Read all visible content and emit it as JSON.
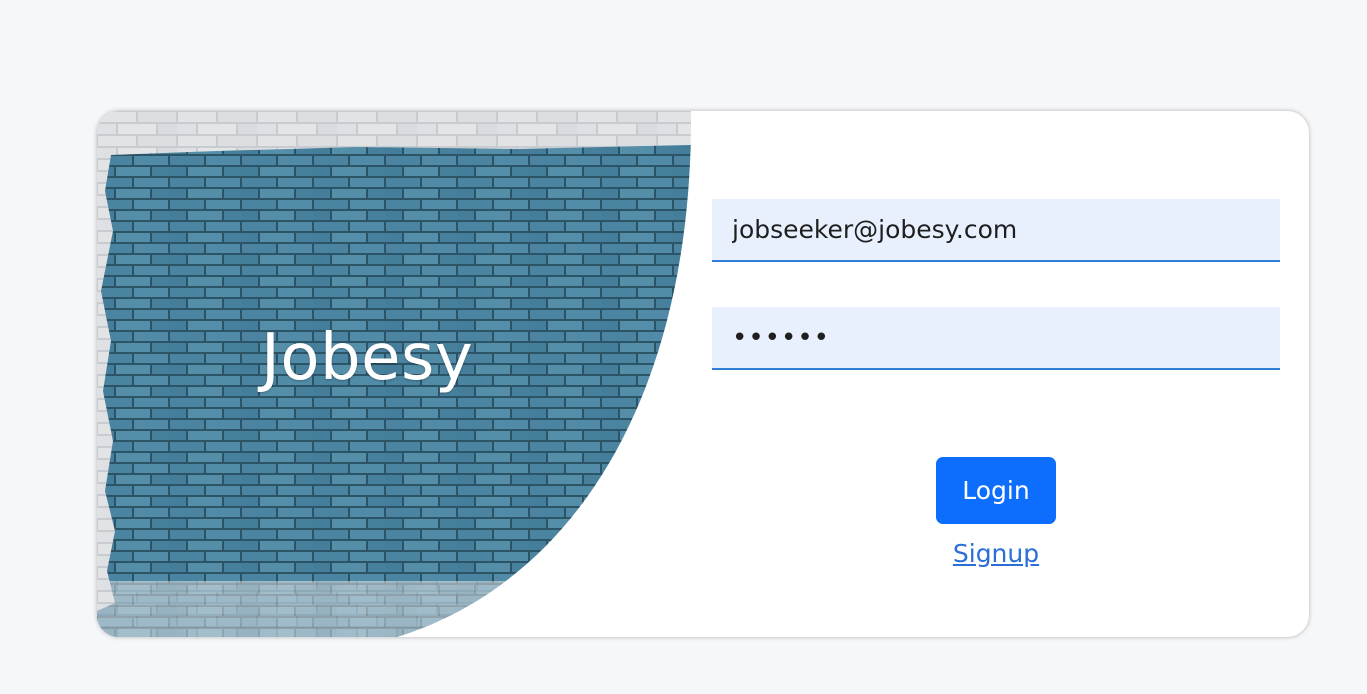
{
  "brand": {
    "name": "Jobesy"
  },
  "login_form": {
    "email_value": "jobseeker@jobesy.com",
    "password_value": "••••••",
    "login_label": "Login",
    "signup_label": "Signup"
  },
  "colors": {
    "page_background": "#f6f7f9",
    "card_background": "#ffffff",
    "field_background": "#e8f0fe",
    "field_underline": "#2f7fd6",
    "primary_button": "#0d6efd",
    "link": "#2a6fd6",
    "brick_blue": "#3e7b99",
    "brick_white": "#d9dcdf"
  }
}
